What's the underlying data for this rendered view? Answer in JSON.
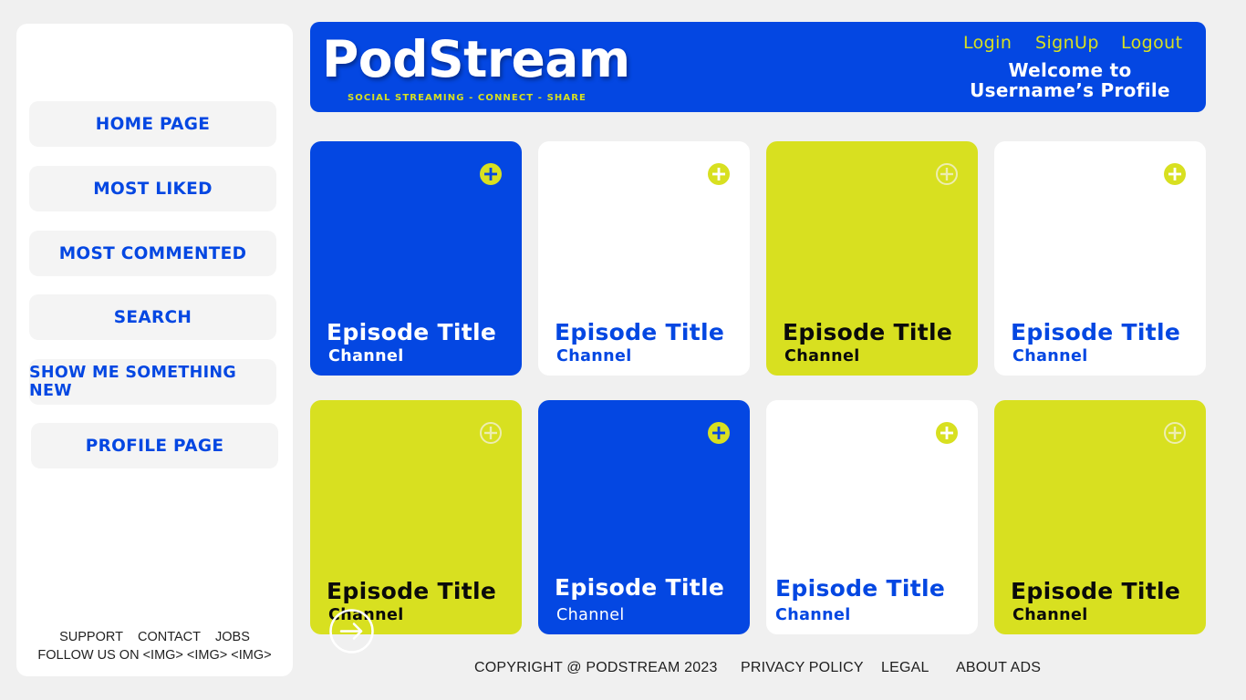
{
  "brand": {
    "name": "PodStream",
    "tagline": "SOCIAL STREAMING - CONNECT - SHARE",
    "colors": {
      "primary": "#0447e2",
      "accent": "#d8e020",
      "background": "#f0f0f0"
    }
  },
  "header": {
    "login": "Login",
    "signup": "SignUp",
    "logout": "Logout",
    "welcome_line1": "Welcome to",
    "welcome_line2": "Username’s Profile"
  },
  "sidebar": {
    "nav": [
      {
        "label": "HOME PAGE"
      },
      {
        "label": "MOST LIKED"
      },
      {
        "label": "MOST COMMENTED"
      },
      {
        "label": "SEARCH"
      },
      {
        "label": "SHOW ME SOMETHING NEW"
      },
      {
        "label": "PROFILE PAGE"
      }
    ],
    "footer": {
      "support": "SUPPORT",
      "contact": "CONTACT",
      "jobs": "JOBS",
      "follow": "FOLLOW US ON <IMG> <IMG> <IMG>"
    }
  },
  "episodes": [
    {
      "title": "Episode Title",
      "channel": "Channel",
      "theme": "blue",
      "icon": "plus-circle-icon"
    },
    {
      "title": "Episode Title",
      "channel": "Channel",
      "theme": "white",
      "icon": "plus-circle-icon"
    },
    {
      "title": "Episode Title",
      "channel": "Channel",
      "theme": "yellow",
      "icon": "plus-circle-icon"
    },
    {
      "title": "Episode Title",
      "channel": "Channel",
      "theme": "white",
      "icon": "plus-circle-icon"
    },
    {
      "title": "Episode Title",
      "channel": "Channel",
      "theme": "yellow",
      "icon": "plus-circle-icon"
    },
    {
      "title": "Episode Title",
      "channel": "Channel",
      "theme": "blue",
      "icon": "plus-circle-icon"
    },
    {
      "title": "Episode Title",
      "channel": "Channel",
      "theme": "white",
      "icon": "plus-circle-icon"
    },
    {
      "title": "Episode Title",
      "channel": "Channel",
      "theme": "yellow",
      "icon": "plus-circle-icon"
    }
  ],
  "footer": {
    "copyright": "COPYRIGHT @ PODSTREAM 2023",
    "privacy": "PRIVACY POLICY",
    "legal": "LEGAL",
    "about_ads": "ABOUT ADS"
  }
}
